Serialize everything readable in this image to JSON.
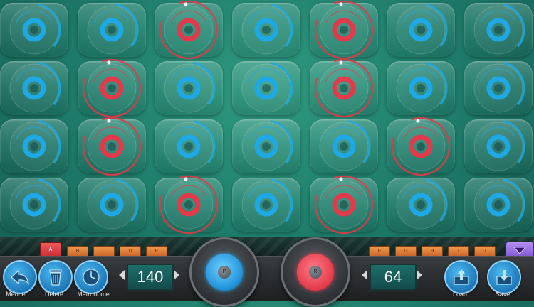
{
  "grid": {
    "rows": [
      [
        "blue",
        "blue",
        "red",
        "blue",
        "red",
        "blue",
        "blue"
      ],
      [
        "blue",
        "red",
        "blue",
        "blue",
        "red",
        "blue",
        "blue"
      ],
      [
        "blue",
        "red",
        "blue",
        "blue",
        "blue",
        "red",
        "blue"
      ],
      [
        "blue",
        "blue",
        "red",
        "blue",
        "red",
        "blue",
        "blue"
      ]
    ],
    "colors": {
      "blue": "#1ea8e6",
      "red": "#e23a4a"
    }
  },
  "pattern_buttons": {
    "left": [
      "A",
      "B",
      "C",
      "D",
      "E"
    ],
    "right": [
      "F",
      "G",
      "H",
      "I",
      "J"
    ],
    "active": "A"
  },
  "toolbar": {
    "menu_label": "Menue",
    "delete_label": "Delete",
    "metronome_label": "Metronome",
    "load_label": "Load",
    "save_label": "Save",
    "tempo_value": "140",
    "second_value": "64",
    "play_cap": "P",
    "record_cap": "R"
  },
  "icons": {
    "menu": "back-arrow-icon",
    "delete": "trash-icon",
    "metronome": "clock-icon",
    "load": "upload-icon",
    "save": "download-icon",
    "collapse": "triangle-down-icon"
  },
  "accent": {
    "play": "#1ea8e6",
    "record": "#e23a4a",
    "pattern_active": "#e03a45",
    "collapse": "#9a70e0"
  }
}
